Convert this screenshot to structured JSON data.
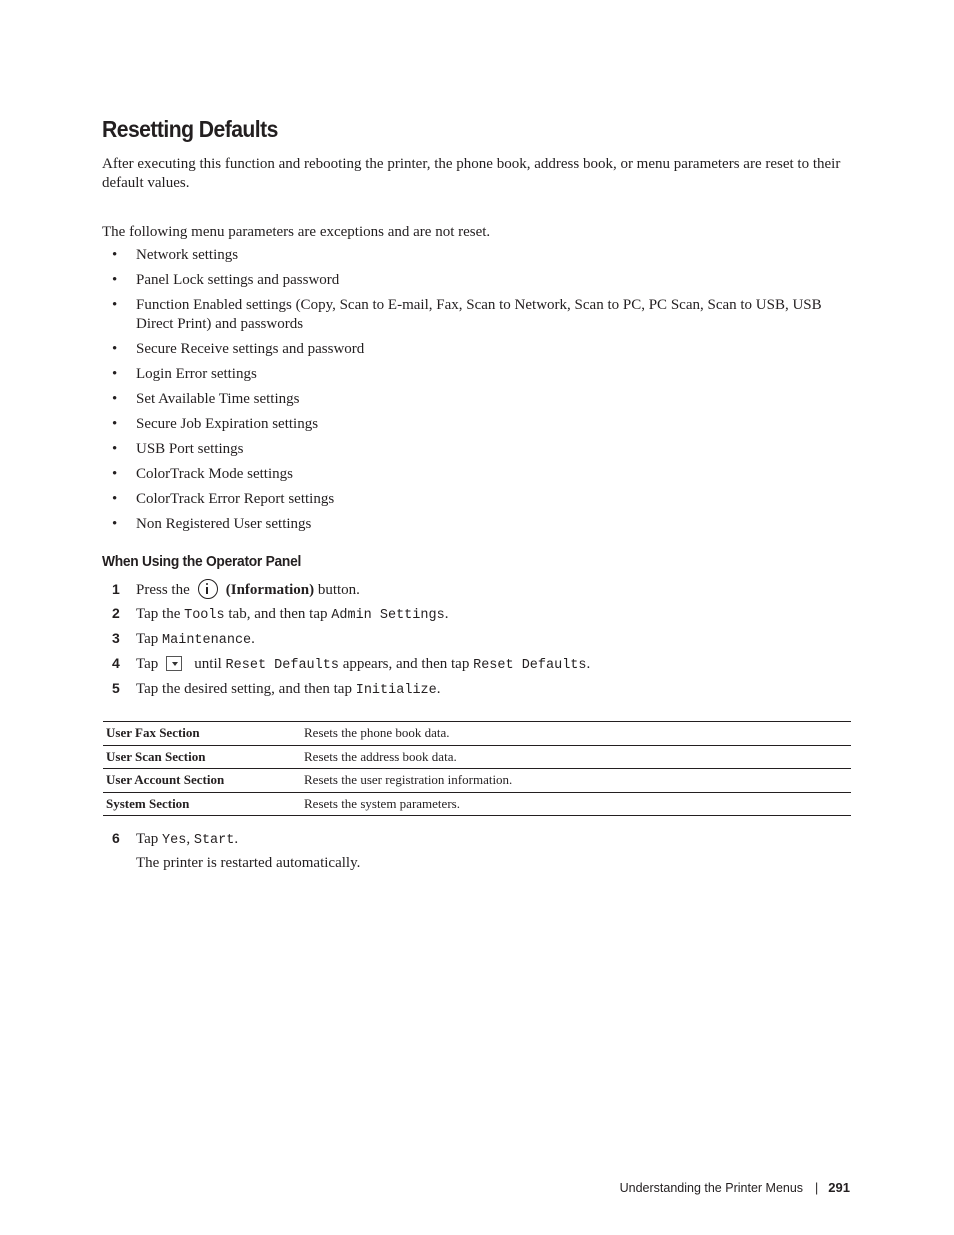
{
  "title": "Resetting Defaults",
  "intro": "After executing this function and rebooting the printer, the phone book, address book, or menu parameters are reset to their default values.",
  "exceptions_intro": "The following menu parameters are exceptions and are not reset.",
  "exceptions": [
    "Network settings",
    "Panel Lock settings and password",
    "Function Enabled settings (Copy, Scan to E-mail, Fax, Scan to Network, Scan to PC, PC Scan, Scan to USB, USB Direct Print) and passwords",
    "Secure Receive settings and password",
    "Login Error settings",
    "Set Available Time settings",
    "Secure Job Expiration settings",
    "USB Port settings",
    "ColorTrack Mode settings",
    "ColorTrack Error Report settings",
    "Non Registered User settings"
  ],
  "subheading": "When Using the Operator Panel",
  "steps": {
    "s1": {
      "num": "1",
      "pre": "Press the",
      "bold": "(Information)",
      "post": "button.",
      "icon": "information-icon"
    },
    "s2": {
      "num": "2",
      "pre": "Tap the",
      "code1": "Tools",
      "mid": "tab, and then tap",
      "code2": "Admin Settings",
      "post": "."
    },
    "s3": {
      "num": "3",
      "pre": "Tap",
      "code1": "Maintenance",
      "post": "."
    },
    "s4": {
      "num": "4",
      "pre": "Tap",
      "icon": "down-arrow-button-icon",
      "mid1": "until",
      "code1": "Reset Defaults",
      "mid2": "appears, and then tap",
      "code2": "Reset Defaults",
      "post": "."
    },
    "s5": {
      "num": "5",
      "pre": "Tap the desired setting, and then tap",
      "code1": "Initialize",
      "post": "."
    },
    "s6": {
      "num": "6",
      "pre": "Tap",
      "code1": "Yes",
      "sep": ",",
      "code2": "Start",
      "post": ".",
      "note": "The printer is restarted automatically."
    }
  },
  "table": [
    {
      "section": "User Fax Section",
      "description": "Resets the phone book data."
    },
    {
      "section": "User Scan Section",
      "description": "Resets the address book data."
    },
    {
      "section": "User Account Section",
      "description": "Resets the user registration information."
    },
    {
      "section": "System Section",
      "description": "Resets the system parameters."
    }
  ],
  "footer": {
    "chapter": "Understanding the Printer Menus",
    "separator": "|",
    "page": "291"
  }
}
